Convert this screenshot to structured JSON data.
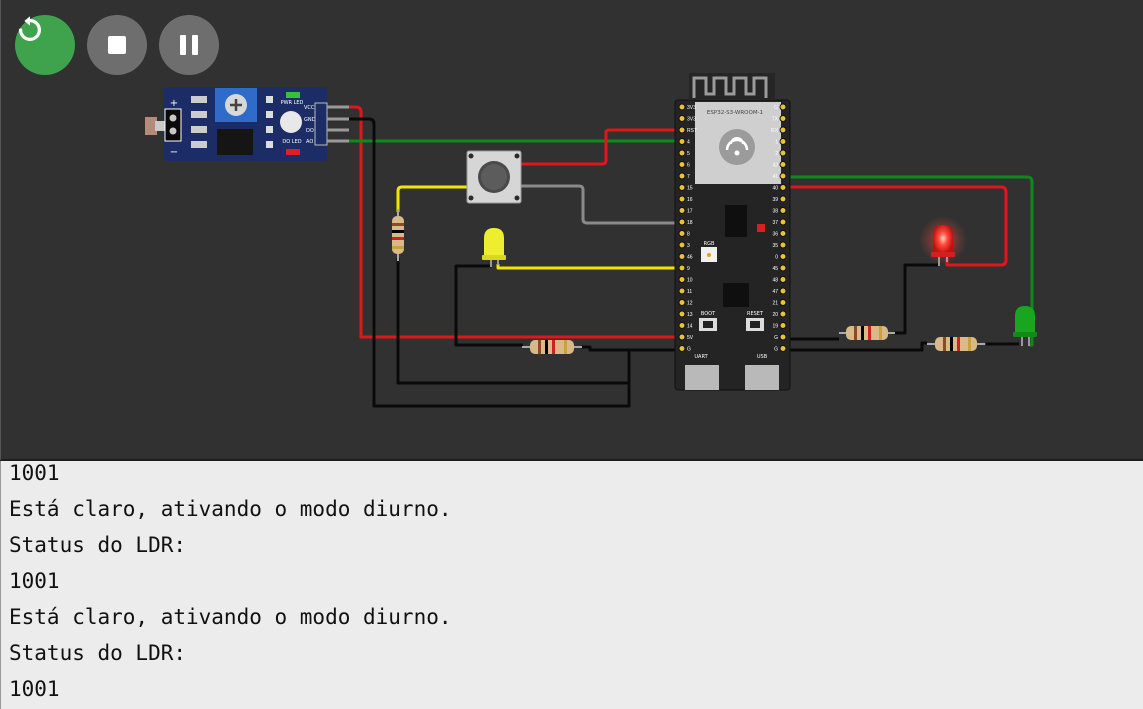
{
  "toolbar": {
    "buttons": [
      {
        "name": "restart",
        "icon": "restart-icon",
        "color": "#3fa34d"
      },
      {
        "name": "stop",
        "icon": "stop-icon",
        "color": "#6e6e6e"
      },
      {
        "name": "pause",
        "icon": "pause-icon",
        "color": "#6e6e6e"
      }
    ]
  },
  "ldr_module": {
    "pins": [
      "VCC",
      "GND",
      "DO",
      "AO"
    ],
    "pwr_led_label": "PWR LED",
    "do_led_label": "DO LED",
    "plus": "+",
    "minus": "−"
  },
  "esp32": {
    "module_label": "ESP32-S3-WROOM-1",
    "left_pins": [
      "3V3",
      "3V3",
      "RST",
      "4",
      "5",
      "6",
      "7",
      "15",
      "16",
      "17",
      "18",
      "8",
      "3",
      "46",
      "9",
      "10",
      "11",
      "12",
      "13",
      "14",
      "5V",
      "G"
    ],
    "right_pins": [
      "G",
      "TX",
      "RX",
      "1",
      "2",
      "42",
      "41",
      "40",
      "39",
      "38",
      "37",
      "36",
      "35",
      "0",
      "45",
      "48",
      "47",
      "21",
      "20",
      "19",
      "G",
      "G"
    ],
    "rgb_label": "RGB",
    "boot_label": "BOOT",
    "reset_label": "RESET",
    "uart_label": "UART",
    "usb_label": "USB"
  },
  "wire_colors": {
    "red": "#e0161b",
    "green": "#0d8a1a",
    "black": "#0a0a0a",
    "yellow": "#f2e600",
    "gray": "#8a8a8a"
  },
  "console": {
    "lines": [
      "1001",
      "Está claro, ativando o modo diurno.",
      "Status do LDR:",
      "1001",
      "Está claro, ativando o modo diurno.",
      "Status do LDR:",
      "1001"
    ]
  }
}
